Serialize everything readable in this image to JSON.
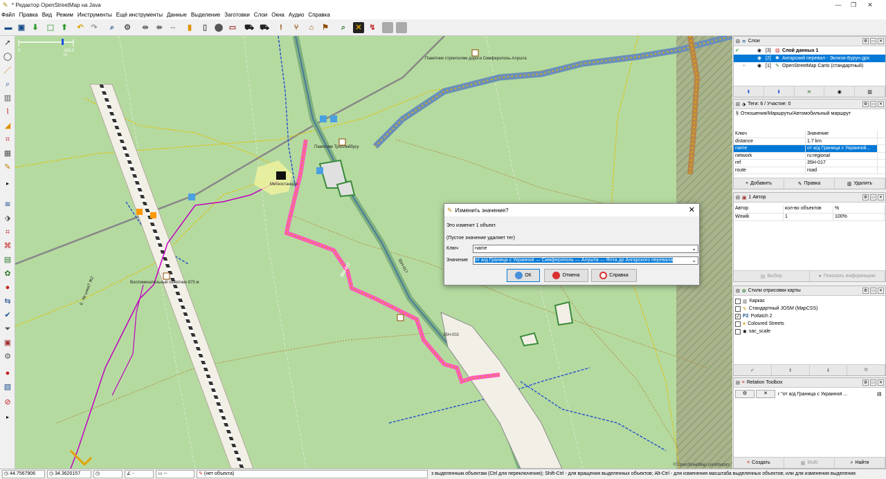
{
  "window": {
    "title": "* Редактор OpenStreetMap на Java",
    "minimize": "—",
    "maximize": "❐",
    "close": "✕"
  },
  "menu": [
    "Файл",
    "Правка",
    "Вид",
    "Режим",
    "Инструменты",
    "Ещё инструменты",
    "Данные",
    "Выделение",
    "Заготовки",
    "Слои",
    "Окна",
    "Аудио",
    "Справка"
  ],
  "map": {
    "scale_label": "200.0 m",
    "scale_zero": "0",
    "labels": {
      "memorial_top": "Памятник строителям дороги Симферополь-Алушта",
      "memorial_troll": "Памятник Троллейбусу",
      "meteo": "Метеостанция",
      "memorial_875": "Воспоминательный памятник 875 м",
      "road_35n": "35Н-017",
      "road_35n_b": "35Н-002",
      "road_35n_c": "35Н-017",
      "trail_6": "6 . № ыэкаТ Ж2",
      "attribution": "© OpenStreetMap contributors"
    }
  },
  "dialog": {
    "title": "Изменить значение?",
    "info": "Это изменит 1 объект.",
    "hint": "(Пустое значение удаляет тег)",
    "key_label": "Ключ",
    "key_value": "name",
    "value_label": "Значение",
    "value_value": "от а/д Граница с Украиной — Симферополь — Алушта — Ялта до Ангарского перевала",
    "ok": "ОК",
    "cancel": "Отмена",
    "help": "Справка"
  },
  "layers": {
    "title": "Слои",
    "rows": [
      {
        "num": "[3]",
        "name": "Слой данных 1"
      },
      {
        "num": "[2]",
        "name": "Ангарский перевал - Эклизи-Бурун.gpx"
      },
      {
        "num": "[1]",
        "name": "OpenStreetMap Carto (стандартный)"
      }
    ]
  },
  "tags": {
    "title": "Теги: 6 / Участие: 0",
    "relation": "Отношения/Маршруты/Автомобильный маршрут",
    "col_key": "Ключ",
    "col_value": "Значение",
    "rows": [
      {
        "k": "distance",
        "v": "1.7 km"
      },
      {
        "k": "name",
        "v": "от а/д Граница с Украиной..."
      },
      {
        "k": "network",
        "v": "ru:regional"
      },
      {
        "k": "ref",
        "v": "35Н-017"
      },
      {
        "k": "route",
        "v": "road"
      }
    ],
    "add": "Добавить",
    "edit": "Правка",
    "delete": "Удалить"
  },
  "authors": {
    "title": "1 Автор",
    "col_author": "Автор",
    "col_count": "кол-во объектов",
    "col_pct": "%",
    "row": {
      "author": "Wowik",
      "count": "1",
      "pct": "100%"
    },
    "select": "Выбор",
    "info": "Показать информацию"
  },
  "styles": {
    "title": "Стили отрисовки карты",
    "rows": [
      {
        "checked": "",
        "name": "Каркас"
      },
      {
        "checked": "",
        "name": "Стандартный JOSM (MapCSS)"
      },
      {
        "checked": "✓",
        "name": "Potlatch 2"
      },
      {
        "checked": "",
        "name": "Coloured Streets"
      },
      {
        "checked": "",
        "name": "sac_scale"
      }
    ]
  },
  "relation_toolbox": {
    "title": "Relation Toolbox",
    "current": "r \"от а/д Граница с Украиной ...",
    "create": "Создать",
    "multi": "Multi",
    "find": "Найти"
  },
  "status": {
    "lat": "44.7567906",
    "lon": "34.3620157",
    "angle": "-",
    "dist": "--",
    "object": "(нет объекта)",
    "hint": "з выделенным объектам (Ctrl для переключения); Shift-Ctrl - для вращения выделенных объектов; Alt-Ctrl - для изменения масштаба выделенных объектов; или для изменения выделения"
  }
}
